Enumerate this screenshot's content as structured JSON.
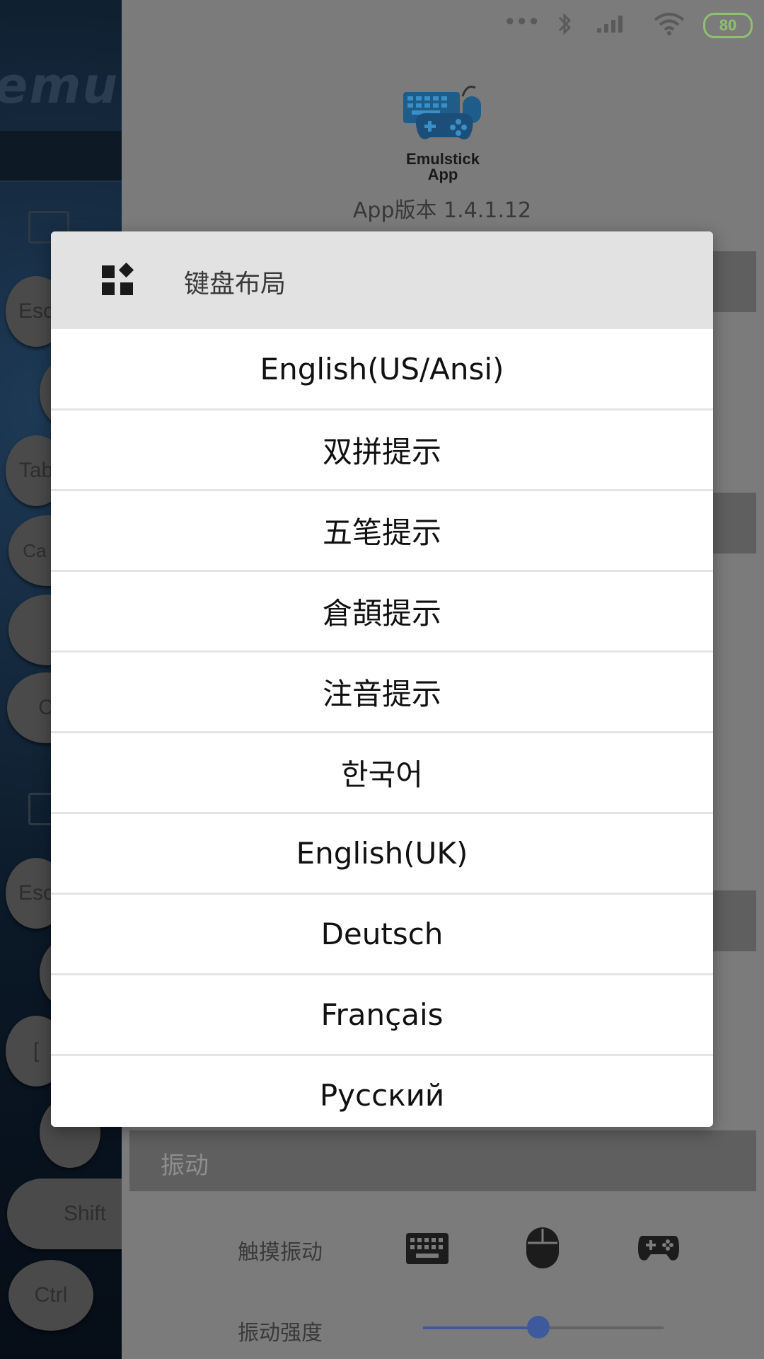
{
  "background_keyboard": {
    "logo_text": "emu",
    "keys": [
      "Esc",
      "Tab",
      "Ca Lo",
      "C",
      "Esc",
      "[",
      "Shift",
      "Ctrl"
    ]
  },
  "status_bar": {
    "battery": "80",
    "icons": [
      "more-dots-icon",
      "bluetooth-icon",
      "signal-icon",
      "wifi-icon",
      "battery-icon"
    ]
  },
  "app_info": {
    "logo_line1": "Emulstick",
    "logo_line2": "App",
    "version": "App版本 1.4.1.12"
  },
  "settings": {
    "vibration_header": "振动",
    "touch_vibration_label": "触摸振动",
    "vibration_strength_label": "振动强度",
    "vibration_strength_value": 0.48,
    "toggle_icons": [
      "keyboard-icon",
      "mouse-icon",
      "gamepad-icon"
    ]
  },
  "dialog": {
    "title": "键盘布局",
    "icon": "widgets-icon",
    "options": [
      "English(US/Ansi)",
      "双拼提示",
      "五笔提示",
      "倉頡提示",
      "注音提示",
      "한국어",
      "English(UK)",
      "Deutsch",
      "Français",
      "Русский"
    ]
  },
  "colors": {
    "accent": "#3e5a9c",
    "battery": "#8fc070",
    "dialog_header": "#e2e2e2"
  }
}
